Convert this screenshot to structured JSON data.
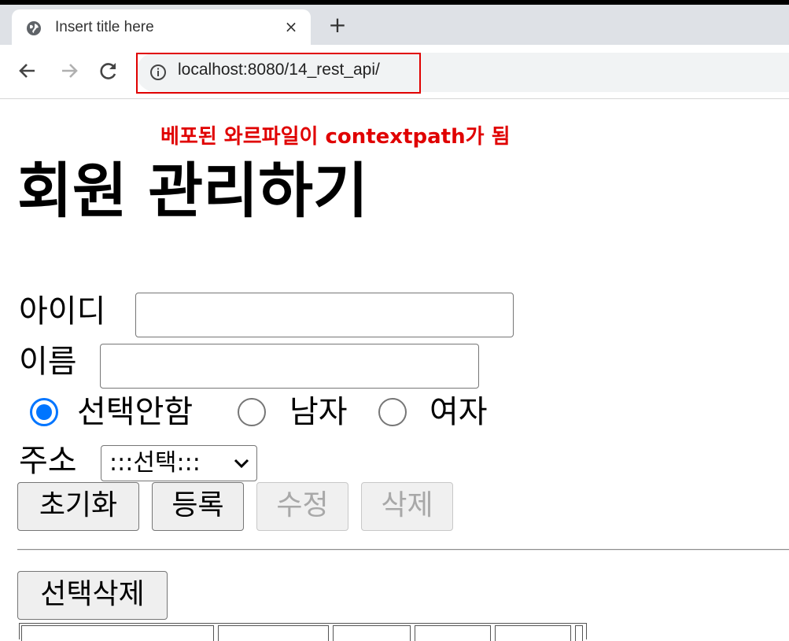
{
  "browser": {
    "tab_title": "Insert title here",
    "tab_close_label": "×",
    "new_tab_label": "+",
    "url": "localhost:8080/14_rest_api/"
  },
  "annotation": {
    "text": "베포된 와르파일이 contextpath가 됨",
    "color": "#e00000"
  },
  "page": {
    "title": "회원 관리하기",
    "form": {
      "id_label": "아이디",
      "id_value": "",
      "name_label": "이름",
      "name_value": "",
      "gender_options": [
        {
          "label": "선택안함",
          "checked": true
        },
        {
          "label": "남자",
          "checked": false
        },
        {
          "label": "여자",
          "checked": false
        }
      ],
      "address_label": "주소",
      "address_selected": ":::선택:::"
    },
    "buttons": {
      "reset": "초기화",
      "register": "등록",
      "edit": "수정",
      "delete": "삭제"
    },
    "bulk_delete": "선택삭제"
  },
  "colors": {
    "accent": "#0075ff",
    "highlight": "#e00000"
  }
}
